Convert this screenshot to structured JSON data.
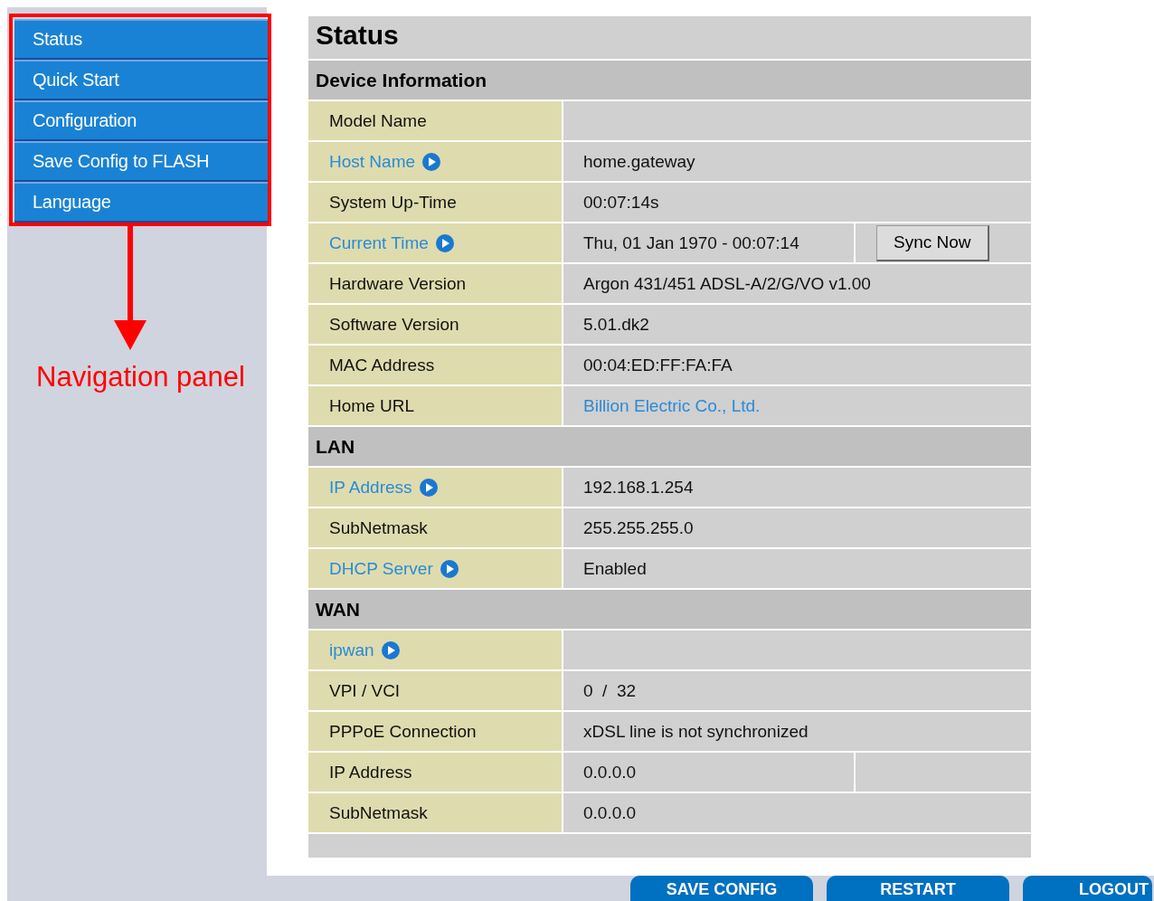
{
  "nav": {
    "items": [
      {
        "label": "Status"
      },
      {
        "label": "Quick Start"
      },
      {
        "label": "Configuration"
      },
      {
        "label": "Save Config to FLASH"
      },
      {
        "label": "Language"
      }
    ]
  },
  "annotation": {
    "label": "Navigation panel"
  },
  "page": {
    "title": "Status",
    "rows": [
      {
        "kind": "section",
        "label": "Device Information"
      },
      {
        "kind": "field",
        "label": "Model Name",
        "link": false
      },
      {
        "kind": "field",
        "label": "Host Name",
        "link": true,
        "value": "home.gateway"
      },
      {
        "kind": "field",
        "label": "System Up-Time",
        "link": false,
        "value": "00:07:14s"
      },
      {
        "kind": "field",
        "label": "Current Time",
        "link": true,
        "value": "Thu, 01 Jan 1970 - 00:07:14",
        "button": "Sync Now"
      },
      {
        "kind": "field",
        "label": "Hardware Version",
        "link": false,
        "value": "Argon 431/451 ADSL-A/2/G/VO v1.00"
      },
      {
        "kind": "field",
        "label": "Software Version",
        "link": false,
        "value": "5.01.dk2"
      },
      {
        "kind": "field",
        "label": "MAC Address",
        "link": false,
        "value": "00:04:ED:FF:FA:FA"
      },
      {
        "kind": "field",
        "label": "Home URL",
        "link": false,
        "value": "Billion Electric Co., Ltd.",
        "value_link": true
      },
      {
        "kind": "section",
        "label": "LAN"
      },
      {
        "kind": "field",
        "label": "IP Address",
        "link": true,
        "value": "192.168.1.254"
      },
      {
        "kind": "field",
        "label": "SubNetmask",
        "link": false,
        "value": "255.255.255.0"
      },
      {
        "kind": "field",
        "label": "DHCP Server",
        "link": true,
        "value": "Enabled"
      },
      {
        "kind": "section",
        "label": "WAN"
      },
      {
        "kind": "field",
        "label": "ipwan",
        "link": true
      },
      {
        "kind": "field",
        "label": "VPI / VCI",
        "link": false,
        "value": "0  /  32"
      },
      {
        "kind": "field",
        "label": "PPPoE Connection",
        "link": false,
        "value": "xDSL line is not synchronized"
      },
      {
        "kind": "field",
        "label": "IP Address",
        "link": false,
        "value": "0.0.0.0",
        "split": true
      },
      {
        "kind": "field",
        "label": "SubNetmask",
        "link": false,
        "value": "0.0.0.0"
      },
      {
        "kind": "blank"
      }
    ]
  },
  "footer_buttons": [
    "SAVE CONFIG",
    "RESTART",
    "LOGOUT"
  ]
}
